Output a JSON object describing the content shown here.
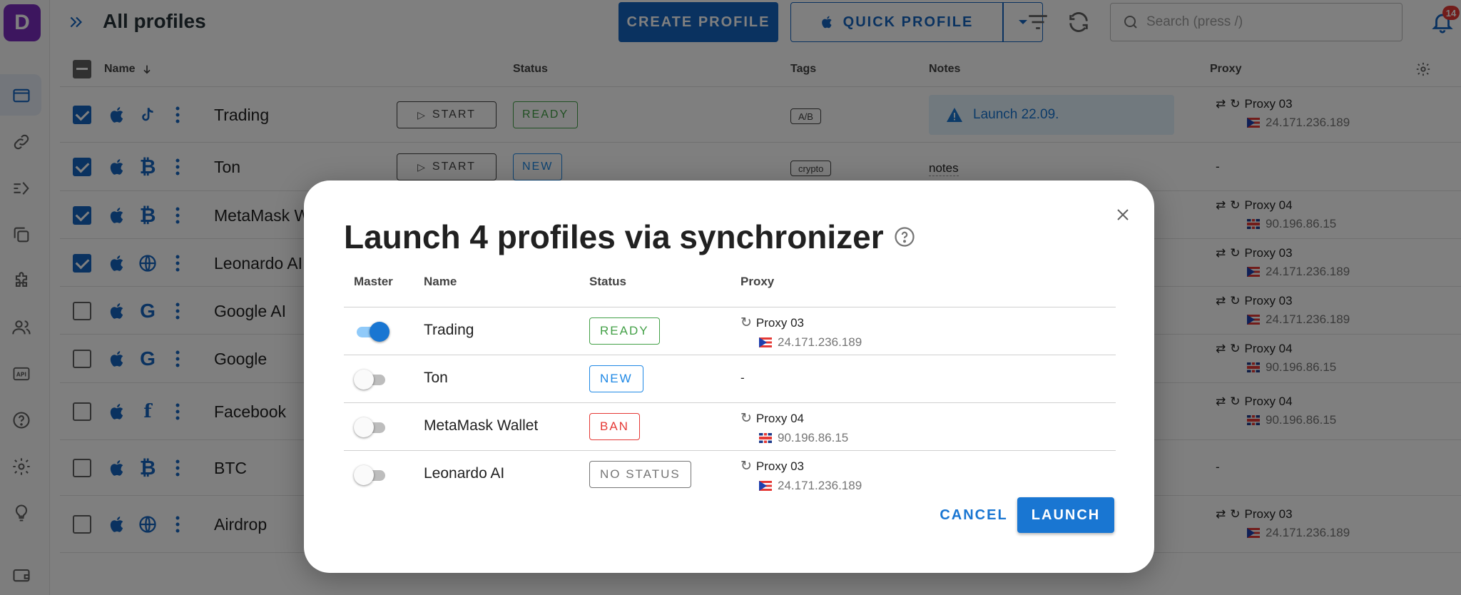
{
  "app": {
    "logo_letter": "D",
    "page_title": "All profiles"
  },
  "toolbar": {
    "create_label": "CREATE PROFILE",
    "quick_label": "QUICK PROFILE",
    "search_placeholder": "Search (press /)",
    "notification_count": "14"
  },
  "table": {
    "headers": {
      "name": "Name",
      "status": "Status",
      "tags": "Tags",
      "notes": "Notes",
      "proxy": "Proxy"
    },
    "start_label": "START",
    "rows": [
      {
        "name": "Trading",
        "checked": true,
        "status": "READY",
        "tag": "A/B",
        "note": "Launch 22.09.",
        "proxy": "Proxy 03",
        "ip": "24.171.236.189"
      },
      {
        "name": "Ton",
        "checked": true,
        "status": "NEW",
        "tag": "crypto",
        "note": "notes",
        "proxy": "-"
      },
      {
        "name": "MetaMask Wallet",
        "checked": true,
        "proxy": "Proxy 04",
        "ip": "90.196.86.15"
      },
      {
        "name": "Leonardo AI",
        "checked": true,
        "proxy": "Proxy 03",
        "ip": "24.171.236.189"
      },
      {
        "name": "Google AI",
        "checked": false,
        "proxy": "Proxy 03",
        "ip": "24.171.236.189"
      },
      {
        "name": "Google",
        "checked": false,
        "proxy": "Proxy 04",
        "ip": "90.196.86.15"
      },
      {
        "name": "Facebook",
        "checked": false,
        "proxy": "Proxy 04",
        "ip": "90.196.86.15"
      },
      {
        "name": "BTC",
        "checked": false,
        "proxy": "-"
      },
      {
        "name": "Airdrop",
        "checked": false,
        "proxy": "Proxy 03",
        "ip": "24.171.236.189"
      }
    ]
  },
  "dialog": {
    "title": "Launch 4 profiles via synchronizer",
    "headers": {
      "master": "Master",
      "name": "Name",
      "status": "Status",
      "proxy": "Proxy"
    },
    "rows": [
      {
        "master": true,
        "name": "Trading",
        "status": "READY",
        "proxy": "Proxy 03",
        "ip": "24.171.236.189"
      },
      {
        "master": false,
        "name": "Ton",
        "status": "NEW",
        "proxy": "-"
      },
      {
        "master": false,
        "name": "MetaMask Wallet",
        "status": "BAN",
        "proxy": "Proxy 04",
        "ip": "90.196.86.15"
      },
      {
        "master": false,
        "name": "Leonardo AI",
        "status": "NO STATUS",
        "proxy": "Proxy 03",
        "ip": "24.171.236.189"
      }
    ],
    "cancel_label": "CANCEL",
    "launch_label": "LAUNCH"
  },
  "colors": {
    "primary": "#1976d2",
    "ready": "#43a047",
    "new": "#1e88e5",
    "ban": "#e53935",
    "no_status": "#757575",
    "logo": "#7b2cbf"
  }
}
